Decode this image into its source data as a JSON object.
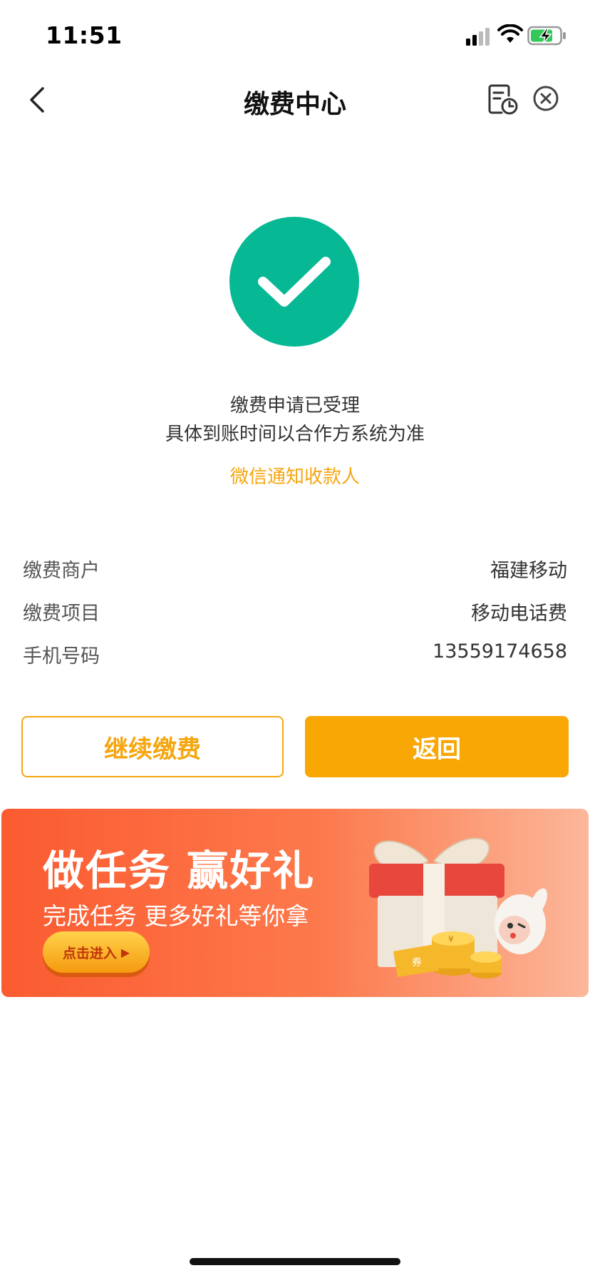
{
  "status_bar": {
    "time": "11:51"
  },
  "nav": {
    "title": "缴费中心"
  },
  "result": {
    "line1": "缴费申请已受理",
    "line2": "具体到账时间以合作方系统为准",
    "notify_link": "微信通知收款人"
  },
  "details": [
    {
      "label": "缴费商户",
      "value": "福建移动"
    },
    {
      "label": "缴费项目",
      "value": "移动电话费"
    },
    {
      "label": "手机号码",
      "value": "13559174658"
    }
  ],
  "buttons": {
    "continue": "继续缴费",
    "return": "返回"
  },
  "banner": {
    "title": "做任务 赢好礼",
    "subtitle": "完成任务 更多好礼等你拿",
    "cta": "点击进入",
    "coin_label": "券"
  },
  "colors": {
    "accent": "#f5a60f",
    "success": "#06b894",
    "banner": "#fb5b30"
  }
}
